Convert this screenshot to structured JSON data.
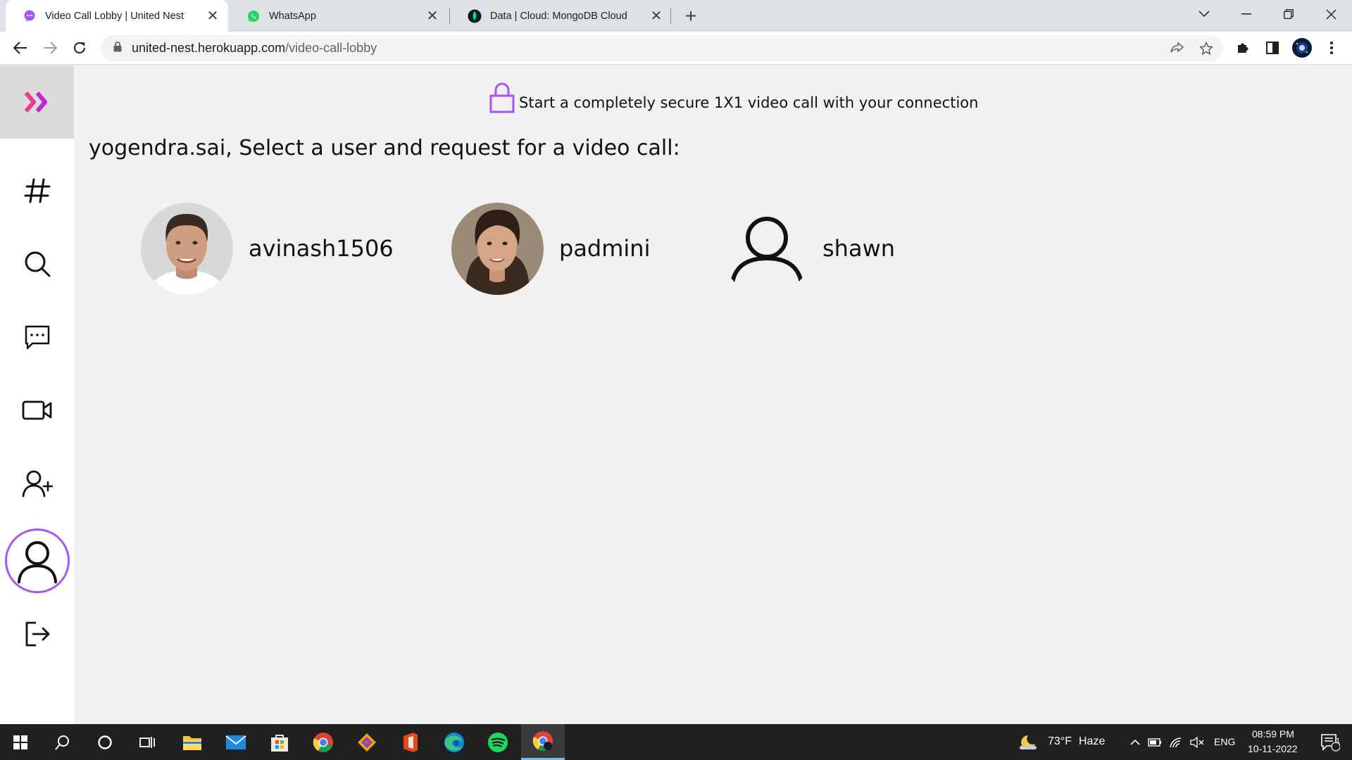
{
  "browser": {
    "tabs": [
      {
        "title": "Video Call Lobby | United Nest",
        "favicon": "chat-bubble-icon",
        "active": true
      },
      {
        "title": "WhatsApp",
        "favicon": "whatsapp-icon",
        "active": false
      },
      {
        "title": "Data | Cloud: MongoDB Cloud",
        "favicon": "mongodb-leaf-icon",
        "active": false
      }
    ],
    "url_host": "united-nest.herokuapp.com",
    "url_path": "/video-call-lobby"
  },
  "sidebar": {
    "items": [
      {
        "name": "channels",
        "icon": "hash-icon"
      },
      {
        "name": "search",
        "icon": "search-icon"
      },
      {
        "name": "messages",
        "icon": "chat-icon"
      },
      {
        "name": "video-call",
        "icon": "video-camera-icon"
      },
      {
        "name": "add-user",
        "icon": "user-plus-icon"
      },
      {
        "name": "profile",
        "icon": "user-icon"
      },
      {
        "name": "logout",
        "icon": "logout-icon"
      }
    ]
  },
  "main": {
    "secure_text": "Start a completely secure 1X1 video call with your connection",
    "prompt": "yogendra.sai, Select a user and request for a video call:",
    "users": [
      {
        "name": "avinash1506"
      },
      {
        "name": "padmini"
      },
      {
        "name": "shawn"
      }
    ]
  },
  "taskbar": {
    "weather_temp": "73°F",
    "weather_desc": "Haze",
    "language": "ENG",
    "time": "08:59 PM",
    "date": "10-11-2022",
    "notification_count": "1"
  },
  "colors": {
    "accent": "#a855f7",
    "logo": "#e83e8c"
  }
}
